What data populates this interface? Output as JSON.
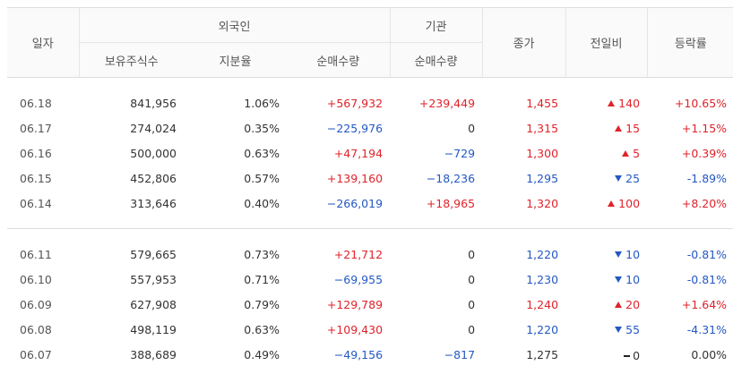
{
  "headers": {
    "date": "일자",
    "foreign": "외국인",
    "institution": "기관",
    "close": "종가",
    "change": "전일비",
    "rate": "등락률",
    "holding": "보유주식수",
    "share": "지분율",
    "foreign_net": "순매수량",
    "inst_net": "순매수량"
  },
  "group1": [
    {
      "date": "06.18",
      "holding": "841,956",
      "share": "1.06%",
      "foreign_net": "+567,932",
      "foreign_dir": "up",
      "inst_net": "+239,449",
      "inst_dir": "up",
      "close": "1,455",
      "close_dir": "up",
      "change": "140",
      "change_dir": "up",
      "rate": "+10.65%",
      "rate_dir": "up"
    },
    {
      "date": "06.17",
      "holding": "274,024",
      "share": "0.35%",
      "foreign_net": "−225,976",
      "foreign_dir": "down",
      "inst_net": "0",
      "inst_dir": "neutral",
      "close": "1,315",
      "close_dir": "up",
      "change": "15",
      "change_dir": "up",
      "rate": "+1.15%",
      "rate_dir": "up"
    },
    {
      "date": "06.16",
      "holding": "500,000",
      "share": "0.63%",
      "foreign_net": "+47,194",
      "foreign_dir": "up",
      "inst_net": "−729",
      "inst_dir": "down",
      "close": "1,300",
      "close_dir": "up",
      "change": "5",
      "change_dir": "up",
      "rate": "+0.39%",
      "rate_dir": "up"
    },
    {
      "date": "06.15",
      "holding": "452,806",
      "share": "0.57%",
      "foreign_net": "+139,160",
      "foreign_dir": "up",
      "inst_net": "−18,236",
      "inst_dir": "down",
      "close": "1,295",
      "close_dir": "down",
      "change": "25",
      "change_dir": "down",
      "rate": "-1.89%",
      "rate_dir": "down"
    },
    {
      "date": "06.14",
      "holding": "313,646",
      "share": "0.40%",
      "foreign_net": "−266,019",
      "foreign_dir": "down",
      "inst_net": "+18,965",
      "inst_dir": "up",
      "close": "1,320",
      "close_dir": "up",
      "change": "100",
      "change_dir": "up",
      "rate": "+8.20%",
      "rate_dir": "up"
    }
  ],
  "group2": [
    {
      "date": "06.11",
      "holding": "579,665",
      "share": "0.73%",
      "foreign_net": "+21,712",
      "foreign_dir": "up",
      "inst_net": "0",
      "inst_dir": "neutral",
      "close": "1,220",
      "close_dir": "down",
      "change": "10",
      "change_dir": "down",
      "rate": "-0.81%",
      "rate_dir": "down"
    },
    {
      "date": "06.10",
      "holding": "557,953",
      "share": "0.71%",
      "foreign_net": "−69,955",
      "foreign_dir": "down",
      "inst_net": "0",
      "inst_dir": "neutral",
      "close": "1,230",
      "close_dir": "down",
      "change": "10",
      "change_dir": "down",
      "rate": "-0.81%",
      "rate_dir": "down"
    },
    {
      "date": "06.09",
      "holding": "627,908",
      "share": "0.79%",
      "foreign_net": "+129,789",
      "foreign_dir": "up",
      "inst_net": "0",
      "inst_dir": "neutral",
      "close": "1,240",
      "close_dir": "up",
      "change": "20",
      "change_dir": "up",
      "rate": "+1.64%",
      "rate_dir": "up"
    },
    {
      "date": "06.08",
      "holding": "498,119",
      "share": "0.63%",
      "foreign_net": "+109,430",
      "foreign_dir": "up",
      "inst_net": "0",
      "inst_dir": "neutral",
      "close": "1,220",
      "close_dir": "down",
      "change": "55",
      "change_dir": "down",
      "rate": "-4.31%",
      "rate_dir": "down"
    },
    {
      "date": "06.07",
      "holding": "388,689",
      "share": "0.49%",
      "foreign_net": "−49,156",
      "foreign_dir": "down",
      "inst_net": "−817",
      "inst_dir": "down",
      "close": "1,275",
      "close_dir": "neutral",
      "change": "0",
      "change_dir": "neutral",
      "rate": "0.00%",
      "rate_dir": "neutral"
    }
  ],
  "colors": {
    "up": "#e0222a",
    "down": "#2358c4",
    "text": "#333333",
    "border": "#dddddd"
  },
  "icons": {
    "up": "triangle-up-icon",
    "down": "triangle-down-icon",
    "neutral": "dash-icon"
  }
}
